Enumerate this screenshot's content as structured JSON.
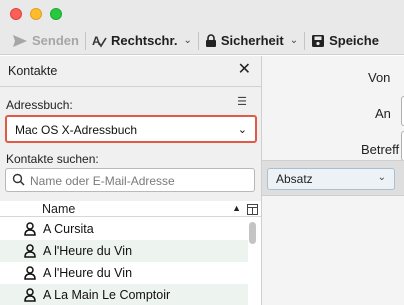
{
  "toolbar": {
    "send_label": "Senden",
    "spelling_label": "Rechtschr.",
    "security_label": "Sicherheit",
    "save_label": "Speiche"
  },
  "sidebar": {
    "title": "Kontakte",
    "addressbook_label": "Adressbuch:",
    "addressbook_value": "Mac OS X-Adressbuch",
    "search_label": "Kontakte suchen:",
    "search_placeholder": "Name oder E-Mail-Adresse",
    "column_name": "Name",
    "contacts": [
      {
        "label": "A Cursita"
      },
      {
        "label": "A l'Heure du Vin"
      },
      {
        "label": "A l'Heure du Vin"
      },
      {
        "label": "A La Main Le Comptoir"
      }
    ]
  },
  "compose": {
    "from_label": "Von",
    "to_label": "An",
    "subject_label": "Betreff",
    "paragraph_format": "Absatz"
  },
  "colors": {
    "highlight_border": "#e05a45",
    "alt_row": "#edf3ee",
    "traffic_red": "#fe5f57",
    "traffic_yellow": "#febc2e",
    "traffic_green": "#28c840"
  }
}
